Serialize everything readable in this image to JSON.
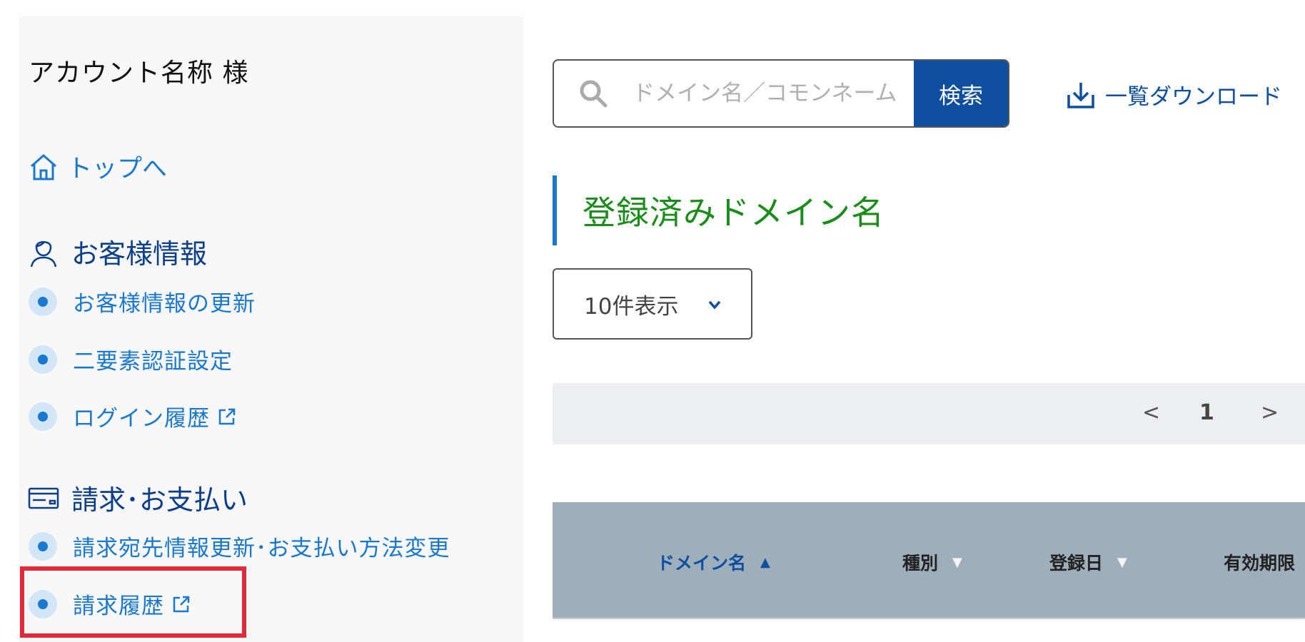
{
  "sidebar": {
    "account_name": "アカウント名称 様",
    "top_link": "トップへ",
    "sections": [
      {
        "title": "お客様情報",
        "items": [
          {
            "label": "お客様情報の更新",
            "external": false
          },
          {
            "label": "二要素認証設定",
            "external": false
          },
          {
            "label": "ログイン履歴",
            "external": true
          }
        ]
      },
      {
        "title": "請求･お支払い",
        "items": [
          {
            "label": "請求宛先情報更新･お支払い方法変更",
            "external": false
          },
          {
            "label": "請求履歴",
            "external": true
          }
        ]
      }
    ]
  },
  "search": {
    "placeholder": "ドメイン名／コモンネーム",
    "button_label": "検索"
  },
  "download_label": "一覧ダウンロード",
  "page_title": "登録済みドメイン名",
  "per_page": "10件表示",
  "pagination": {
    "prev": "<",
    "current": "1",
    "next": ">"
  },
  "table": {
    "columns": [
      {
        "label": "ドメイン名",
        "sort": "▲"
      },
      {
        "label": "種別",
        "sort": "▼"
      },
      {
        "label": "登録日",
        "sort": "▼"
      },
      {
        "label": "有効期限",
        "sort": ""
      }
    ]
  },
  "colors": {
    "accent_blue": "#1a78cf",
    "dark_blue": "#0d4f9e",
    "title_green": "#1a8c1a",
    "highlight_red": "#e02a3a"
  }
}
